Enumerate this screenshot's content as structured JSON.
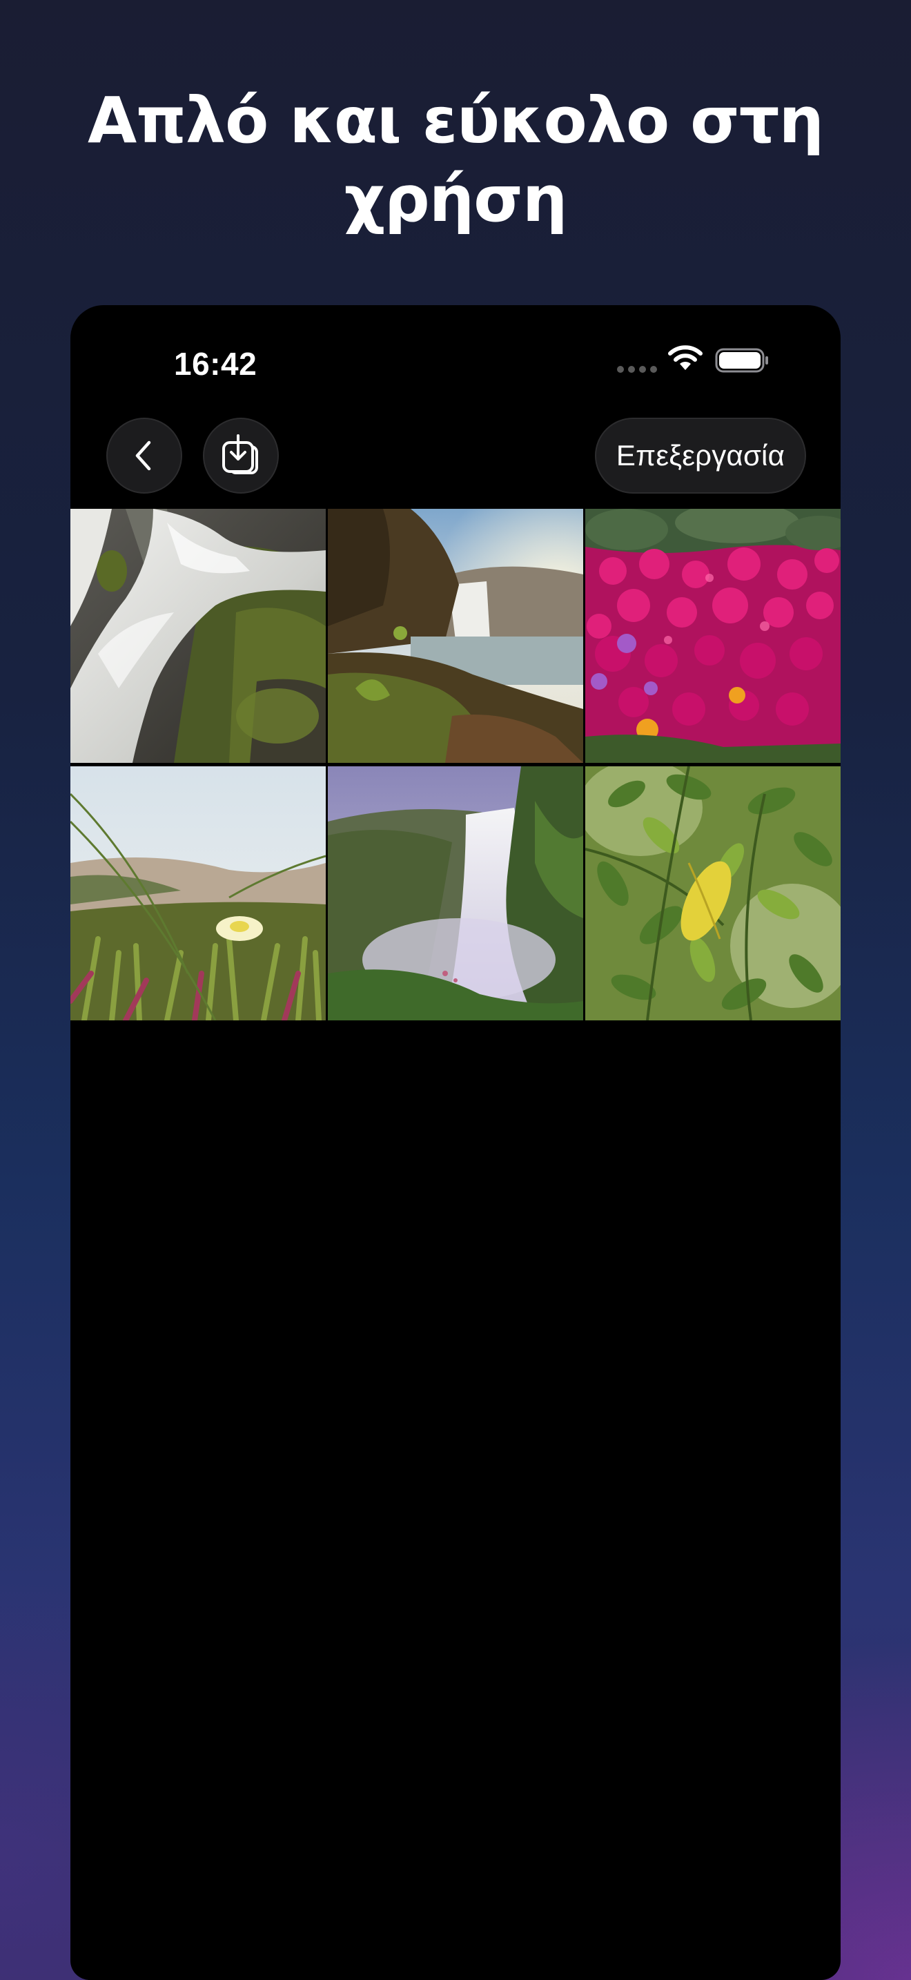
{
  "headline": {
    "line1": "Απλό και εύκολο στη",
    "line2": "χρήση"
  },
  "status_bar": {
    "time": "16:42",
    "icons": [
      "cellular-signal-icon",
      "wifi-icon",
      "battery-icon"
    ]
  },
  "nav": {
    "back_icon": "chevron-left-icon",
    "save_icon": "save-download-icon",
    "edit_label": "Επεξεργασία"
  },
  "photos": [
    {
      "subject": "waterfall-rocks-moss"
    },
    {
      "subject": "waterfall-coast-sunrise"
    },
    {
      "subject": "magenta-flower-field"
    },
    {
      "subject": "ice-plant-dunes"
    },
    {
      "subject": "waterfall-mist-valley"
    },
    {
      "subject": "green-leaves-yellow-leaf"
    }
  ],
  "colors": {
    "device_background": "#000000",
    "button_background": "#1c1c1e",
    "text": "#ffffff"
  }
}
